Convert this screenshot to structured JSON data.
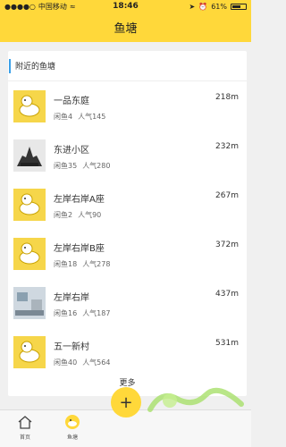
{
  "status": {
    "carrier": "中国移动",
    "time": "18:46",
    "battery": "61%"
  },
  "nav": {
    "title": "鱼塘"
  },
  "section": {
    "title": "附近的鱼塘"
  },
  "ponds": [
    {
      "name": "一品东庭",
      "distance": "218m",
      "idle": "闲鱼4",
      "popularity": "人气145"
    },
    {
      "name": "东进小区",
      "distance": "232m",
      "idle": "闲鱼35",
      "popularity": "人气280"
    },
    {
      "name": "左岸右岸A座",
      "distance": "267m",
      "idle": "闲鱼2",
      "popularity": "人气90"
    },
    {
      "name": "左岸右岸B座",
      "distance": "372m",
      "idle": "闲鱼18",
      "popularity": "人气278"
    },
    {
      "name": "左岸右岸",
      "distance": "437m",
      "idle": "闲鱼16",
      "popularity": "人气187"
    },
    {
      "name": "五一新村",
      "distance": "531m",
      "idle": "闲鱼40",
      "popularity": "人气564"
    }
  ],
  "more_label": "更多",
  "tabs": [
    {
      "label": "首页"
    },
    {
      "label": "鱼塘"
    }
  ],
  "colors": {
    "accent": "#ffd83a",
    "section_bar": "#3aa0e8"
  }
}
